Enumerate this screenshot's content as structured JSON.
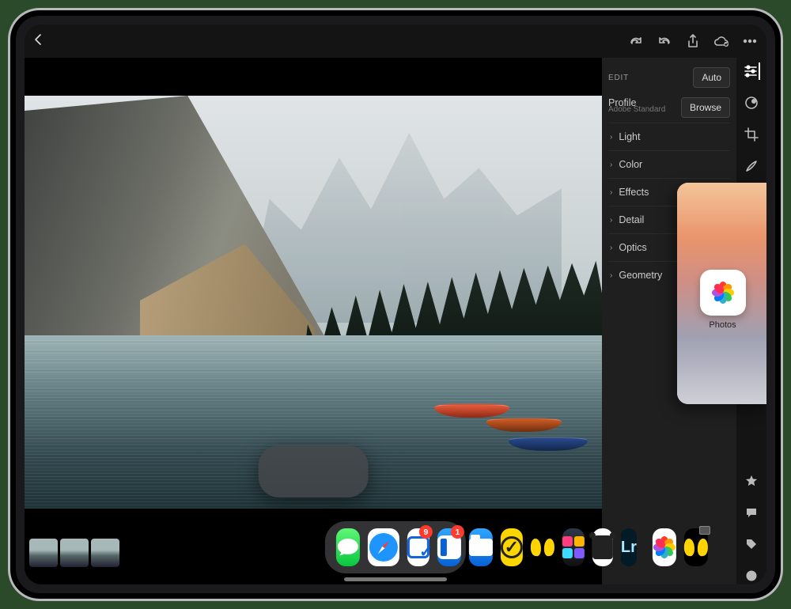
{
  "topbar": {
    "back_icon": "chevron-left"
  },
  "panel": {
    "edit_label": "EDIT",
    "auto_label": "Auto",
    "profile_label": "Profile",
    "profile_value": "Adobe Standard",
    "browse_label": "Browse",
    "sections": [
      "Light",
      "Color",
      "Effects",
      "Detail",
      "Optics",
      "Geometry"
    ]
  },
  "slideover": {
    "app_label": "Photos"
  },
  "dock": {
    "apps": [
      {
        "name": "messages",
        "badge": null
      },
      {
        "name": "safari",
        "badge": null
      },
      {
        "name": "things",
        "badge": "9"
      },
      {
        "name": "outlook",
        "badge": "1"
      },
      {
        "name": "files",
        "badge": null
      },
      {
        "name": "basecamp",
        "badge": null
      },
      {
        "name": "bookmarks",
        "badge": null
      },
      {
        "name": "shortcuts",
        "badge": null
      },
      {
        "name": "bear",
        "badge": null
      },
      {
        "name": "lightroom",
        "badge": null
      }
    ],
    "recent": [
      {
        "name": "photos"
      },
      {
        "name": "bookmarks-alt"
      }
    ]
  }
}
